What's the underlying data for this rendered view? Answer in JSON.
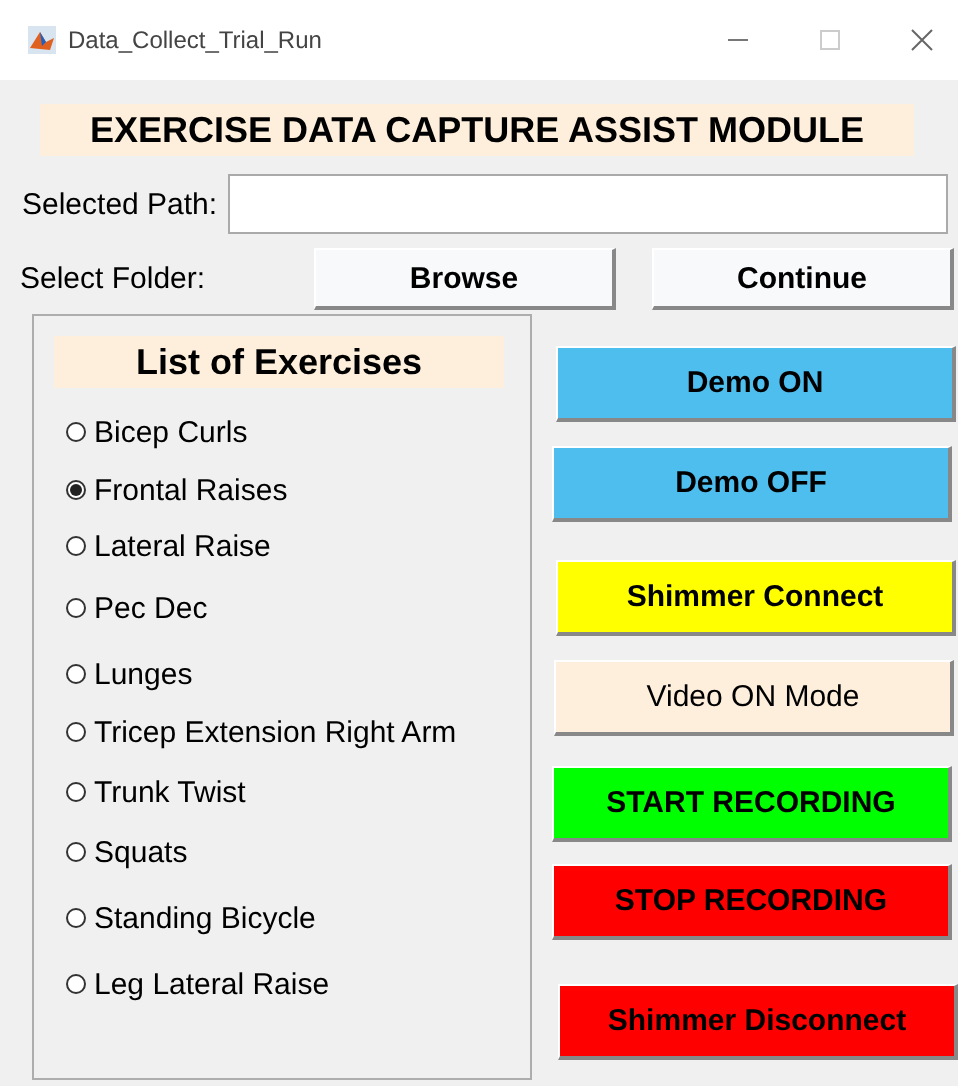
{
  "window": {
    "title": "Data_Collect_Trial_Run"
  },
  "heading": "EXERCISE DATA CAPTURE ASSIST MODULE",
  "path": {
    "label": "Selected Path:"
  },
  "folder": {
    "label": "Select Folder:",
    "buttons": [
      "Browse",
      "Continue"
    ]
  },
  "exercises": {
    "title": "List of Exercises",
    "items": [
      {
        "label": "Bicep Curls",
        "selected": false
      },
      {
        "label": "Frontal Raises",
        "selected": true
      },
      {
        "label": "Lateral Raise",
        "selected": false
      },
      {
        "label": "Pec Dec",
        "selected": false
      },
      {
        "label": "Lunges",
        "selected": false
      },
      {
        "label": "Tricep Extension Right Arm",
        "selected": false
      },
      {
        "label": "Trunk Twist",
        "selected": false
      },
      {
        "label": "Squats",
        "selected": false
      },
      {
        "label": "Standing Bicycle",
        "selected": false
      },
      {
        "label": "Leg Lateral Raise",
        "selected": false
      }
    ]
  },
  "actions": [
    {
      "label": "Demo ON",
      "color": "#4dbeee",
      "kind": "action"
    },
    {
      "label": "Demo OFF",
      "color": "#4dbeee",
      "kind": "action"
    },
    {
      "label": "Shimmer Connect",
      "color": "#ffff00",
      "kind": "action"
    },
    {
      "label": "Video ON Mode",
      "color": "#fdefdc",
      "kind": "mode"
    },
    {
      "label": "START RECORDING",
      "color": "#00ff00",
      "kind": "action"
    },
    {
      "label": "STOP RECORDING",
      "color": "#ff0000",
      "kind": "action"
    },
    {
      "label": "Shimmer Disconnect",
      "color": "#ff0000",
      "kind": "action"
    }
  ]
}
